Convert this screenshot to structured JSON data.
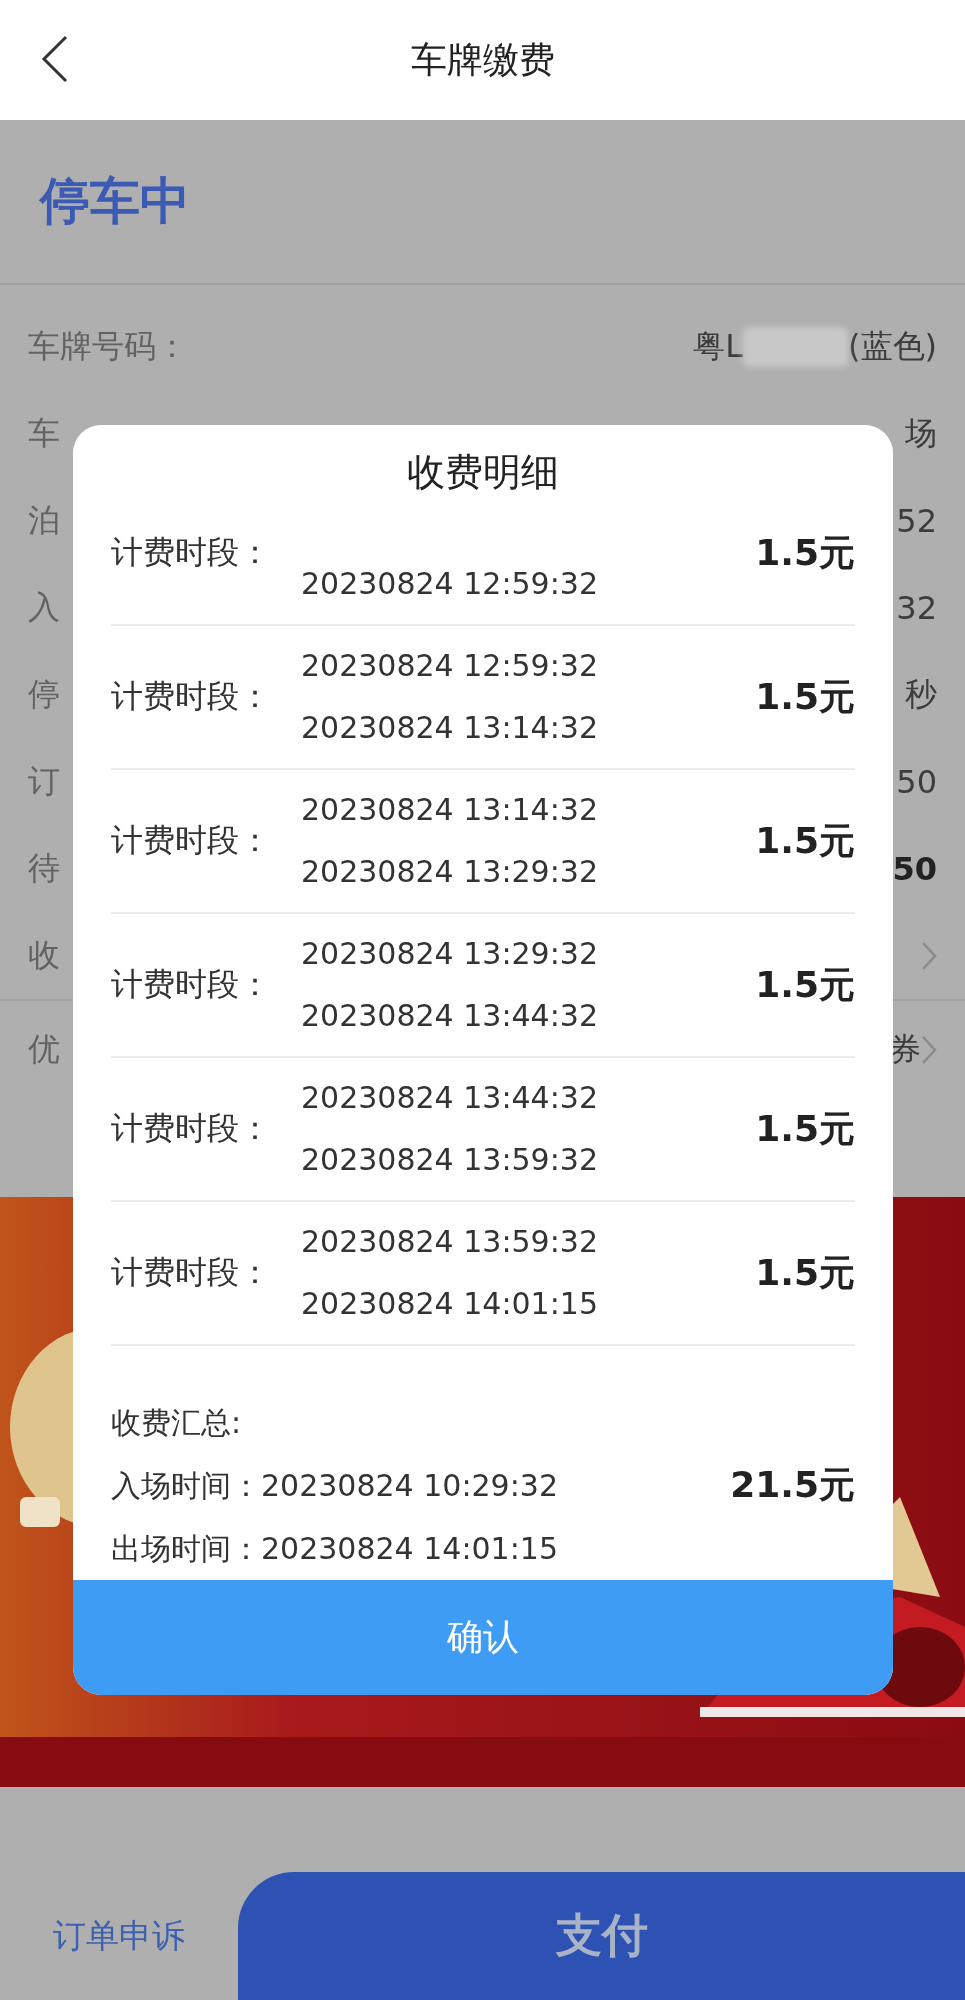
{
  "header": {
    "title": "车牌缴费"
  },
  "status": "停车中",
  "details": [
    {
      "kind": "plate",
      "label": "车牌号码：",
      "prefix": "粤L",
      "suffix": "(蓝色)"
    },
    {
      "kind": "text",
      "label": "车",
      "value": "场"
    },
    {
      "kind": "text",
      "label": "泊",
      "value": "52"
    },
    {
      "kind": "text",
      "label": "入",
      "value": "32"
    },
    {
      "kind": "text",
      "label": "停",
      "value": "秒"
    },
    {
      "kind": "text",
      "label": "订",
      "value": "50"
    },
    {
      "kind": "bold",
      "label": "待",
      "value": "50"
    },
    {
      "kind": "link",
      "label": "收"
    }
  ],
  "coupon": {
    "label": "优",
    "value": "券"
  },
  "modal": {
    "title": "收费明细",
    "periods": [
      {
        "label": "计费时段：",
        "end": "20230824 12:59:32",
        "amount": "1.5元"
      },
      {
        "label": "计费时段：",
        "start": "20230824 12:59:32",
        "end": "20230824 13:14:32",
        "amount": "1.5元"
      },
      {
        "label": "计费时段：",
        "start": "20230824 13:14:32",
        "end": "20230824 13:29:32",
        "amount": "1.5元"
      },
      {
        "label": "计费时段：",
        "start": "20230824 13:29:32",
        "end": "20230824 13:44:32",
        "amount": "1.5元"
      },
      {
        "label": "计费时段：",
        "start": "20230824 13:44:32",
        "end": "20230824 13:59:32",
        "amount": "1.5元"
      },
      {
        "label": "计费时段：",
        "start": "20230824 13:59:32",
        "end": "20230824 14:01:15",
        "amount": "1.5元"
      }
    ],
    "summary": {
      "title": "收费汇总:",
      "entry": "入场时间：20230824 10:29:32",
      "exit": "出场时间：20230824 14:01:15",
      "total": "21.5元"
    },
    "confirm": "确认"
  },
  "footer": {
    "appeal": "订单申诉",
    "pay": "支付"
  }
}
